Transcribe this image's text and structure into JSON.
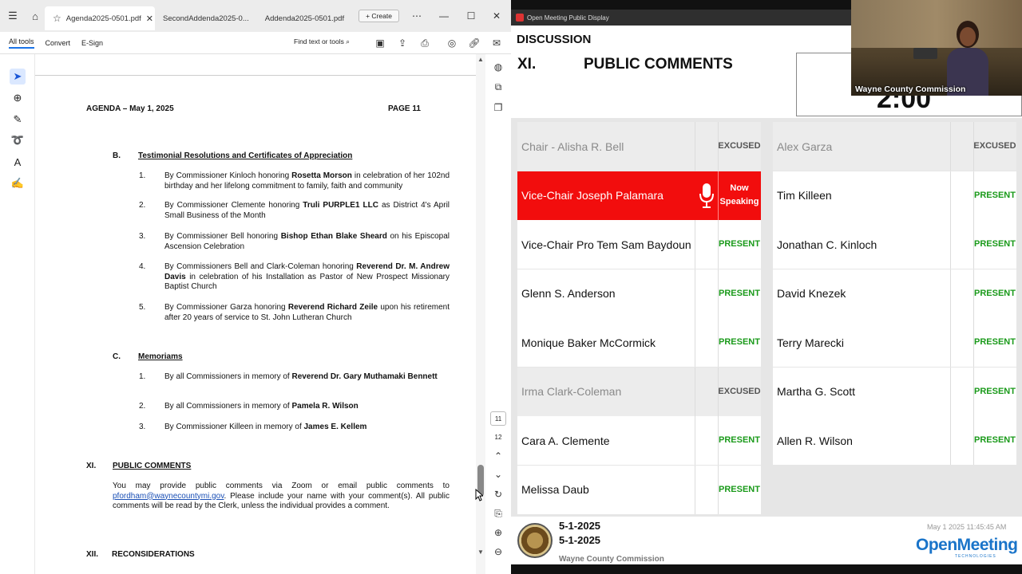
{
  "pdf": {
    "tabs": [
      "Agenda2025-0501.pdf",
      "SecondAddenda2025-0...",
      "Addenda2025-0501.pdf"
    ],
    "create_label": "Create",
    "toolbar": {
      "all_tools": "All tools",
      "convert": "Convert",
      "esign": "E-Sign",
      "find": "Find text or tools"
    },
    "page_header_left": "AGENDA – May 1, 2025",
    "page_header_right": "PAGE 11",
    "section_b": {
      "letter": "B.",
      "title": "Testimonial Resolutions and Certificates of Appreciation",
      "items": [
        {
          "num": "1.",
          "pre": "By Commissioner Kinloch honoring ",
          "bold": "Rosetta Morson",
          "post": " in celebration of her 102nd birthday and her lifelong commitment to family, faith and community"
        },
        {
          "num": "2.",
          "pre": "By Commissioner Clemente honoring ",
          "bold": "Truli PURPLE1 LLC",
          "post": " as District 4's April Small Business of the Month"
        },
        {
          "num": "3.",
          "pre": "By Commissioner Bell honoring ",
          "bold": "Bishop Ethan Blake Sheard",
          "post": " on his Episcopal Ascension Celebration"
        },
        {
          "num": "4.",
          "pre": "By Commissioners Bell and Clark-Coleman honoring ",
          "bold": "Reverend Dr. M. Andrew Davis",
          "post": " in celebration of his Installation as Pastor of New Prospect Missionary Baptist Church"
        },
        {
          "num": "5.",
          "pre": "By Commissioner Garza honoring ",
          "bold": "Reverend Richard Zeile",
          "post": " upon his retirement after 20 years of service to St. John Lutheran Church"
        }
      ]
    },
    "section_c": {
      "letter": "C.",
      "title": "Memoriams",
      "items": [
        {
          "num": "1.",
          "pre": "By all Commissioners in memory of ",
          "bold": "Reverend Dr. Gary Muthamaki Bennett",
          "post": ""
        },
        {
          "num": "2.",
          "pre": "By all Commissioners in memory of ",
          "bold": "Pamela R. Wilson",
          "post": ""
        },
        {
          "num": "3.",
          "pre": "By Commissioner Killeen in memory of ",
          "bold": "James E. Kellem",
          "post": ""
        }
      ]
    },
    "section_xi": {
      "num": "XI.",
      "title": "PUBLIC COMMENTS",
      "para_pre": "You may provide public comments via Zoom or email public comments to ",
      "email": "pfordham@waynecountymi.gov",
      "para_post": ". Please include your name with your comment(s). All public comments will be read by the Clerk, unless the individual provides a comment."
    },
    "section_xii": {
      "num": "XII.",
      "title": "RECONSIDERATIONS"
    },
    "page_numbers": [
      "11",
      "12"
    ]
  },
  "om": {
    "window_title": "Open Meeting Public Display",
    "heading": "DISCUSSION",
    "item_no": "XI.",
    "item_title": "PUBLIC COMMENTS",
    "timer": "2:00",
    "members_left": [
      {
        "name": "Chair - Alisha R. Bell",
        "status": "EXCUSED",
        "state": "excused"
      },
      {
        "name": "Vice-Chair Joseph Palamara",
        "status": "Now Speaking",
        "state": "speaking"
      },
      {
        "name": "Vice-Chair Pro Tem Sam Baydoun",
        "status": "PRESENT",
        "state": "present"
      },
      {
        "name": "Glenn S. Anderson",
        "status": "PRESENT",
        "state": "present"
      },
      {
        "name": "Monique Baker McCormick",
        "status": "PRESENT",
        "state": "present"
      },
      {
        "name": "Irma Clark-Coleman",
        "status": "EXCUSED",
        "state": "excused"
      },
      {
        "name": "Cara A. Clemente",
        "status": "PRESENT",
        "state": "present"
      },
      {
        "name": "Melissa Daub",
        "status": "PRESENT",
        "state": "present"
      }
    ],
    "members_right": [
      {
        "name": "Alex Garza",
        "status": "EXCUSED",
        "state": "excused"
      },
      {
        "name": "Tim Killeen",
        "status": "PRESENT",
        "state": "present"
      },
      {
        "name": "Jonathan C. Kinloch",
        "status": "PRESENT",
        "state": "present"
      },
      {
        "name": "David Knezek",
        "status": "PRESENT",
        "state": "present"
      },
      {
        "name": "Terry Marecki",
        "status": "PRESENT",
        "state": "present"
      },
      {
        "name": "Martha G. Scott",
        "status": "PRESENT",
        "state": "present"
      },
      {
        "name": "Allen R. Wilson",
        "status": "PRESENT",
        "state": "present"
      }
    ],
    "footer": {
      "date1": "5-1-2025",
      "date2": "5-1-2025",
      "org": "Wayne County Commission",
      "timestamp": "May 1 2025 11:45:45 AM",
      "logo": "OpenMeeting",
      "logo_sub": "TECHNOLOGIES"
    }
  },
  "cam": {
    "label": "Wayne County Commission"
  },
  "colors": {
    "speaking": "#f20d0d",
    "present": "#1a9a1a",
    "excused_bg": "#ececec",
    "link": "#1a4fb5"
  },
  "icons": [
    "menu-icon",
    "home-icon",
    "star-icon",
    "close-icon",
    "minimize-icon",
    "maximize-icon",
    "select-icon",
    "zoom-icon",
    "pen-icon",
    "lasso-icon",
    "text-select-icon",
    "signature-icon",
    "microphone-icon"
  ]
}
